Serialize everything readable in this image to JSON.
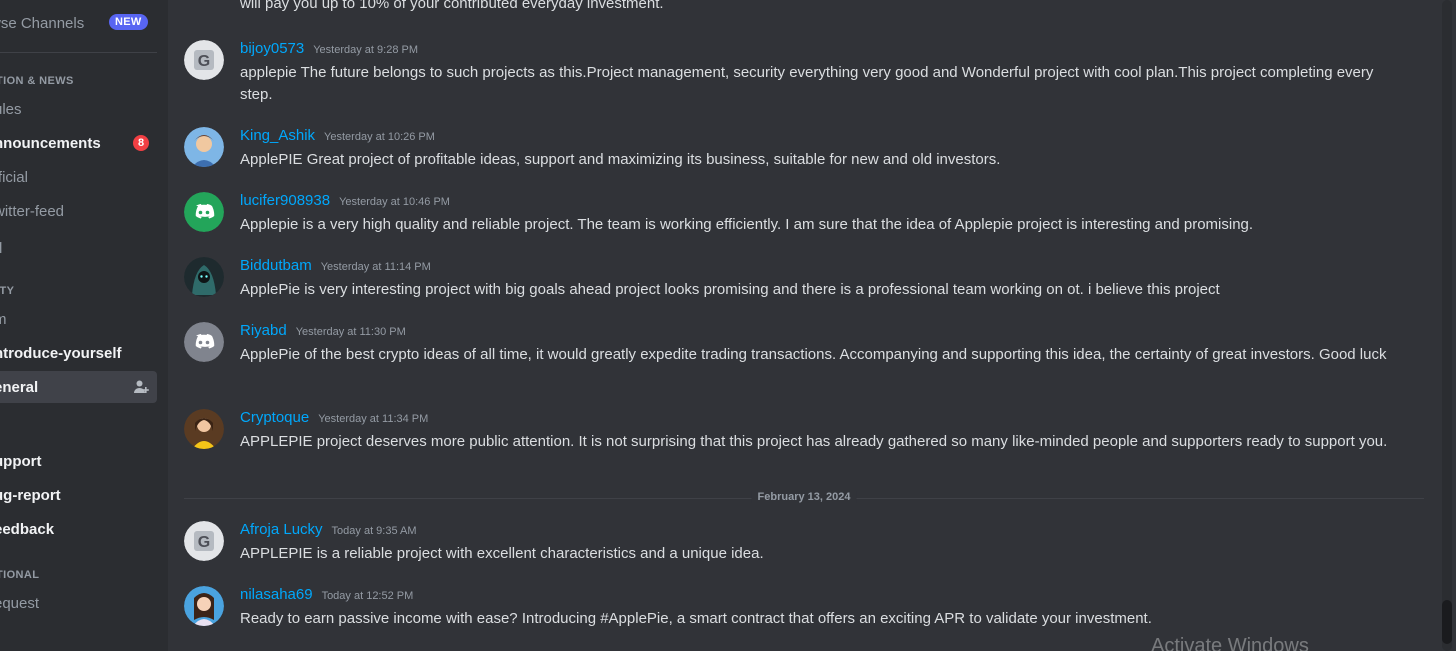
{
  "sidebar": {
    "browse_label": "wse Channels",
    "new_badge": "NEW",
    "categories": [
      {
        "label": "TION & NEWS"
      },
      {
        "label": "ITY"
      },
      {
        "label": "TIONAL"
      }
    ],
    "channels": [
      {
        "label": "ules"
      },
      {
        "label": "nnouncements",
        "badge": "8"
      },
      {
        "label": "fficial"
      },
      {
        "label": "witter-feed"
      },
      {
        "label": "q"
      },
      {
        "label": "m"
      },
      {
        "label": "ntroduce-yourself"
      },
      {
        "label": "eneral"
      },
      {
        "label": "upport"
      },
      {
        "label": "ug-report"
      },
      {
        "label": "eedback"
      },
      {
        "label": "equest"
      }
    ]
  },
  "chat": {
    "partial_message": "will pay you up to 10% of your contributed everyday investment.",
    "date_separator": "February 13, 2024",
    "messages": [
      {
        "username": "bijoy0573",
        "timestamp": "Yesterday at 9:28 PM",
        "text": "applepie The future belongs to such projects as this.Project management, security everything very good and Wonderful project with cool plan.This project completing every step."
      },
      {
        "username": "King_Ashik",
        "timestamp": "Yesterday at 10:26 PM",
        "text": "ApplePIE Great project of profitable ideas, support and maximizing its business, suitable for new and old investors."
      },
      {
        "username": "lucifer908938",
        "timestamp": "Yesterday at 10:46 PM",
        "text": "Applepie is a very high quality and reliable project. The team is working efficiently. I am sure that the idea of Applepie project is interesting and promising."
      },
      {
        "username": "Biddutbam",
        "timestamp": "Yesterday at 11:14 PM",
        "text": "ApplePie is very interesting project with big goals ahead project looks promising and there is a professional team working on ot. i believe this project"
      },
      {
        "username": "Riyabd",
        "timestamp": "Yesterday at 11:30 PM",
        "text": "ApplePie of the best crypto ideas of all time, it would greatly expedite trading transactions. Accompanying and supporting this idea, the certainty of great investors. Good luck"
      },
      {
        "username": "Cryptoque",
        "timestamp": "Yesterday at 11:34 PM",
        "text": "APPLEPIE project deserves more public attention. It is not surprising that this project has already gathered so many like-minded people and supporters ready to support you."
      },
      {
        "username": "Afroja Lucky",
        "timestamp": "Today at 9:35 AM",
        "text": "APPLEPIE is a reliable project with excellent characteristics and a unique idea."
      },
      {
        "username": "nilasaha69",
        "timestamp": "Today at 12:52 PM",
        "text": "Ready to earn passive income with ease? Introducing #ApplePie, a smart contract that offers an exciting APR to validate your investment."
      }
    ]
  },
  "watermark": "Activate Windows",
  "colors": {
    "username": "#00a8fc",
    "mention": "#f23f43",
    "new_badge": "#5865f2",
    "discord_green": "#23a55a",
    "discord_grey": "#80848e"
  }
}
